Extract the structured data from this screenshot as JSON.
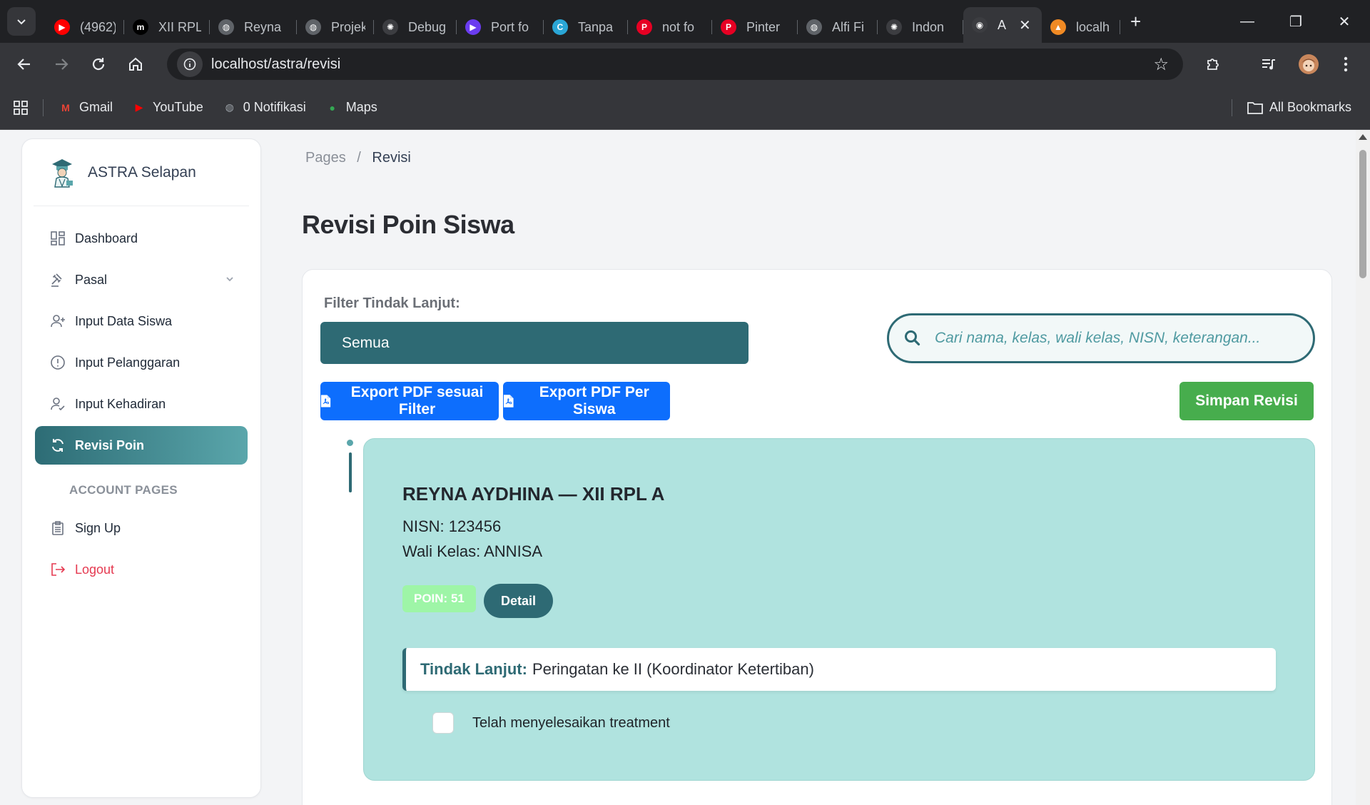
{
  "browser": {
    "tabs": [
      {
        "title": "(4962)",
        "icon": "youtube-icon",
        "color": "#ff0000",
        "glyph": "▶"
      },
      {
        "title": "XII RPL",
        "icon": "medium-icon",
        "color": "#000000",
        "glyph": "m"
      },
      {
        "title": "Reyna",
        "icon": "globe-icon",
        "color": "#5f6368",
        "glyph": "◍"
      },
      {
        "title": "Projek",
        "icon": "globe-icon",
        "color": "#5f6368",
        "glyph": "◍"
      },
      {
        "title": "Debug",
        "icon": "chatgpt-icon",
        "color": "#3c3d41",
        "glyph": "✺"
      },
      {
        "title": "Port fo",
        "icon": "video-icon",
        "color": "#6a3cf0",
        "glyph": "▶"
      },
      {
        "title": "Tanpa",
        "icon": "canva-icon",
        "color": "#2aa6d6",
        "glyph": "C"
      },
      {
        "title": "not fo",
        "icon": "pinterest-icon",
        "color": "#e60023",
        "glyph": "P"
      },
      {
        "title": "Pinter",
        "icon": "pinterest-icon",
        "color": "#e60023",
        "glyph": "P"
      },
      {
        "title": "Alfi Fi",
        "icon": "globe-icon",
        "color": "#5f6368",
        "glyph": "◍"
      },
      {
        "title": "Indon",
        "icon": "chatgpt-icon",
        "color": "#3c3d41",
        "glyph": "✺"
      },
      {
        "title": "A",
        "icon": "astra-icon",
        "color": "#3c3d41",
        "glyph": "◉",
        "active": true
      },
      {
        "title": "localh",
        "icon": "xampp-icon",
        "color": "#f08a24",
        "glyph": "▲"
      }
    ],
    "url": "localhost/astra/revisi",
    "bookmarks": [
      {
        "label": "Gmail",
        "icon": "gmail-icon",
        "color": "#ea4335",
        "glyph": "M"
      },
      {
        "label": "YouTube",
        "icon": "youtube-icon",
        "color": "#ff0000",
        "glyph": "▶"
      },
      {
        "label": "0 Notifikasi",
        "icon": "globe-icon",
        "color": "#9aa0a6",
        "glyph": "◍"
      },
      {
        "label": "Maps",
        "icon": "maps-pin-icon",
        "color": "#34a853",
        "glyph": "●"
      }
    ],
    "all_bookmarks": "All Bookmarks"
  },
  "sidebar": {
    "brand": "ASTRA Selapan",
    "items": [
      {
        "label": "Dashboard",
        "icon": "dashboard-grid-icon"
      },
      {
        "label": "Pasal",
        "icon": "gavel-icon",
        "has_caret": true
      },
      {
        "label": "Input Data Siswa",
        "icon": "user-plus-icon"
      },
      {
        "label": "Input Pelanggaran",
        "icon": "alert-circle-icon"
      },
      {
        "label": "Input Kehadiran",
        "icon": "user-check-icon"
      },
      {
        "label": "Revisi Poin",
        "icon": "refresh-icon",
        "active": true
      }
    ],
    "section_label": "ACCOUNT PAGES",
    "account_items": [
      {
        "label": "Sign Up",
        "icon": "clipboard-icon"
      },
      {
        "label": "Logout",
        "icon": "logout-icon"
      }
    ]
  },
  "main": {
    "breadcrumb": {
      "parent": "Pages",
      "separator": "/",
      "current": "Revisi"
    },
    "title": "Revisi Poin Siswa",
    "filter": {
      "label": "Filter Tindak Lanjut:",
      "selected": "Semua"
    },
    "search": {
      "placeholder": "Cari nama, kelas, wali kelas, NISN, keterangan..."
    },
    "buttons": {
      "export_filter": "Export PDF sesuai Filter",
      "export_student": "Export PDF Per Siswa",
      "save": "Simpan Revisi"
    },
    "student": {
      "heading": "REYNA AYDHINA — XII RPL A",
      "nisn": "NISN: 123456",
      "wali": "Wali Kelas: ANNISA",
      "poin": "POIN: 51",
      "detail_label": "Detail",
      "tindak_label": "Tindak Lanjut:",
      "tindak_value": "Peringatan ke II (Koordinator Ketertiban)",
      "treatment_label": "Telah menyelesaikan treatment",
      "treatment_done": false
    }
  },
  "colors": {
    "primary_teal": "#2e6a74",
    "card_teal": "#b0e3df",
    "export_blue": "#0d6efd",
    "save_green": "#47ad4d",
    "logout_red": "#e53950"
  }
}
